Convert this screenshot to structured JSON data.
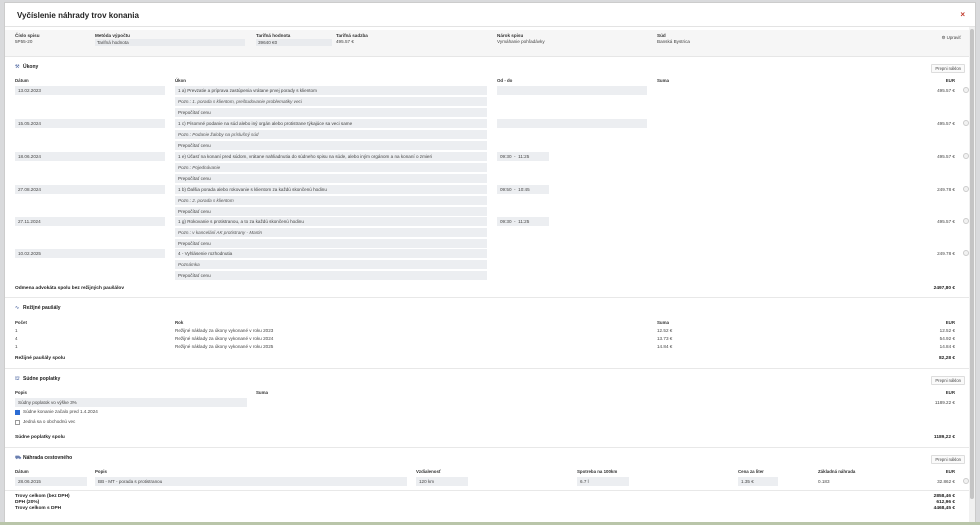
{
  "header": {
    "title": "Vyčíslenie náhrady trov konania",
    "close": "×"
  },
  "info": {
    "cislo_label": "Číslo spisu",
    "cislo_value": "5P55-20",
    "metoda_label": "Metóda výpočtu",
    "metoda_value": "Tarifná hodnota",
    "tarifna_hodnota_label": "Tarifná hodnota",
    "tarifna_hodnota_value": "39640 €0",
    "tarifna_sadzba_label": "Tarifná sadzba",
    "tarifna_sadzba_value": "495.57 €",
    "narok_label": "Nárok spisu",
    "narok_value": "Vymáhanie pohľadávky",
    "sud_label": "Súd",
    "sud_value": "Banská Bystrica",
    "upravit": "Upraviť"
  },
  "ukony": {
    "title": "Úkony",
    "prepni": "Prepni náklon",
    "col_datum": "Dátum",
    "col_ukon": "Úkon",
    "col_od_do": "Od - do",
    "col_suma": "Suma",
    "col_eur": "EUR",
    "rows": [
      {
        "date": "13.02.2023",
        "ukon": "1 a) Prevzatie a príprava zastúpenia vrátane prvej porady s klientom",
        "note": "Pozn.: 1. porada s klientom, preštudovanie problematiky veci",
        "prepocet": "Prepočítať cenu",
        "od": "",
        "do": "",
        "eur": "495.57 €"
      },
      {
        "date": "15.05.2024",
        "ukon": "1 c) Písomné podanie na súd alebo iný orgán alebo protistrane týkajúce sa veci same",
        "note": "Pozn.: Podanie žaloby na príslušný súd",
        "prepocet": "Prepočítať cenu",
        "od": "",
        "do": "",
        "eur": "495.57 €"
      },
      {
        "date": "18.06.2024",
        "ukon": "1 e) Účasť na konaní pred súdom, vrátane nahliadnutia do súdneho spisu na súde, alebo iným orgánom a na konaní o zmieri",
        "note": "Pozn.: Pojednávanie",
        "prepocet": "Prepočítať cenu",
        "od": "09:30",
        "do": "11:25",
        "eur": "495.57 €"
      },
      {
        "date": "27.08.2024",
        "ukon": "1 b) Ďalšia porada alebo rokovanie s klientom za každú skončenú hodinu",
        "note": "Pozn.: 2. porada s klientom",
        "prepocet": "Prepočítať cenu",
        "od": "09:50",
        "do": "10:45",
        "eur": "249.78 €"
      },
      {
        "date": "27.11.2024",
        "ukon": "1 g) Rokovanie s protistranou, a to za každú skončenú hodinu",
        "note": "Pozn.: v kancelárii AK protistrany - Martin",
        "prepocet": "Prepočítať cenu",
        "od": "09:30",
        "do": "11:25",
        "eur": "495.57 €"
      },
      {
        "date": "10.02.2025",
        "ukon": "4 - Vyhlásenie rozhodnutia",
        "note": "Poznámka",
        "prepocet": "Prepočítať cenu",
        "od": "",
        "do": "",
        "eur": "249.78 €"
      }
    ],
    "total_label": "Odmena advokáta spolu bez režijných paušálov",
    "total_value": "2497,80 €"
  },
  "rezijne": {
    "title": "Režijné paušály",
    "col_pocet": "Počet",
    "col_rok": "Rok",
    "col_suma": "Suma",
    "col_eur": "EUR",
    "rows": [
      {
        "pocet": "1",
        "rok": "Režijné náklady za úkony vykonané v roku 2023",
        "suma": "12.52 €",
        "eur": "12.52 €"
      },
      {
        "pocet": "4",
        "rok": "Režijné náklady za úkony vykonané v roku 2024",
        "suma": "13.73 €",
        "eur": "54.92 €"
      },
      {
        "pocet": "1",
        "rok": "Režijné náklady za úkony vykonané v roku 2025",
        "suma": "14.84 €",
        "eur": "14.84 €"
      }
    ],
    "total_label": "Režijné paušály spolu",
    "total_value": "82,28 €"
  },
  "sudne": {
    "title": "Súdne poplatky",
    "prepni": "Prepni náklon",
    "col_popis": "Popis",
    "col_suma": "Suma",
    "col_eur": "EUR",
    "popis_value": "Súdny poplatok vo výške 3%",
    "eur": "1189.22 €",
    "check1": "Súdne konanie začalo pred 1.4.2024",
    "check2": "Jedná sa o obchodnú vec",
    "total_label": "Súdne poplatky spolu",
    "total_value": "1189,22 €"
  },
  "cestovne": {
    "title": "Náhrada cestovného",
    "prepni": "Prepni náklon",
    "col_datum": "Dátum",
    "col_popis": "Popis",
    "col_vzdialenost": "Vzdialenosť",
    "col_spotreba": "Spotreba na 100km",
    "col_cena": "Cena za liter",
    "col_zakladna": "Základná náhrada",
    "col_eur": "EUR",
    "datum": "28.06.2015",
    "popis": "BB - MT - porada s protistranou",
    "vzdialenost": "120 km",
    "spotreba": "6.7 l",
    "cena": "1.35 €",
    "zakladna": "0.183",
    "eur": "32.862 €"
  },
  "summary": {
    "bez_dph_label": "Trovy celkom (bez DPH)",
    "bez_dph_value": "2858,46 €",
    "dph_label": "DPH (20%)",
    "dph_value": "612,96 €",
    "s_dph_label": "Trovy celkom s DPH",
    "s_dph_value": "4468,45 €"
  }
}
